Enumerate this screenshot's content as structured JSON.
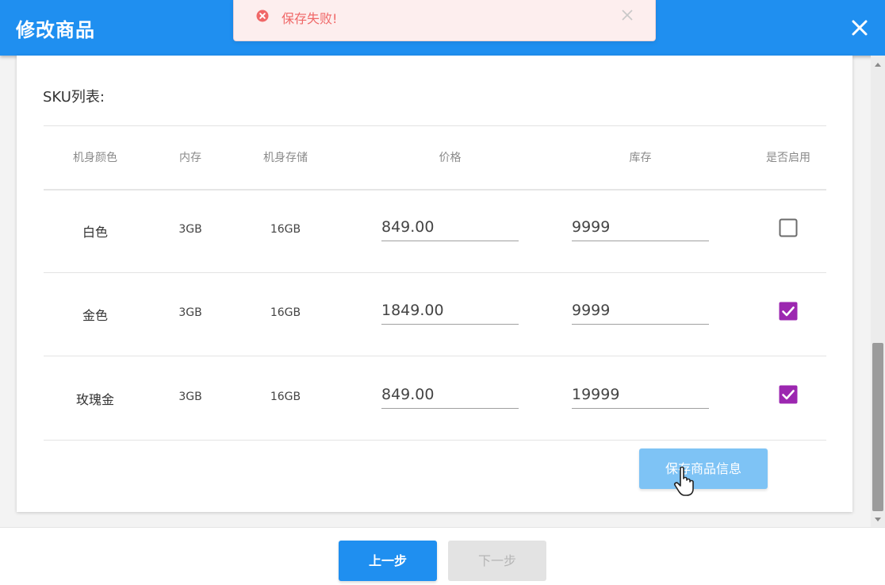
{
  "header": {
    "title": "修改商品",
    "close_icon": "close-icon"
  },
  "toast": {
    "icon": "error-circle-icon",
    "message": "保存失败!",
    "close_icon": "close-icon",
    "color": "#f06868"
  },
  "sku": {
    "title": "SKU列表:",
    "columns": [
      "机身颜色",
      "内存",
      "机身存储",
      "价格",
      "库存",
      "是否启用"
    ],
    "rows": [
      {
        "color": "白色",
        "memory": "3GB",
        "storage": "16GB",
        "price": "849.00",
        "stock": "9999",
        "enabled": false
      },
      {
        "color": "金色",
        "memory": "3GB",
        "storage": "16GB",
        "price": "1849.00",
        "stock": "9999",
        "enabled": true
      },
      {
        "color": "玫瑰金",
        "memory": "3GB",
        "storage": "16GB",
        "price": "849.00",
        "stock": "19999",
        "enabled": true
      }
    ],
    "save_label": "保存商品信息"
  },
  "footer": {
    "prev_label": "上一步",
    "next_label": "下一步"
  },
  "colors": {
    "primary": "#1f8ff0",
    "checkbox": "#9c27b0",
    "save_button": "#7ec3f5"
  }
}
